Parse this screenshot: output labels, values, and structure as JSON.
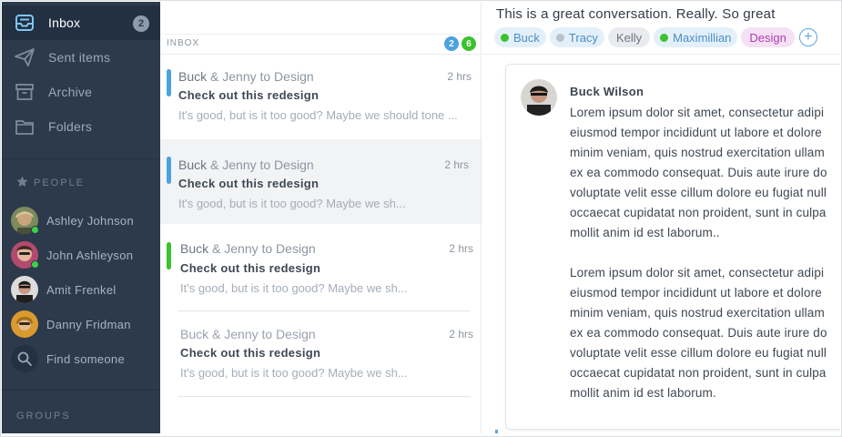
{
  "colors": {
    "sidebar_bg": "#2d3a4c",
    "sidebar_active": "#233041",
    "accent_blue": "#5aa7dd",
    "accent_green": "#3bd14a",
    "tag_design": "#c13fbf"
  },
  "sidebar": {
    "nav": [
      {
        "label": "Inbox",
        "icon": "inbox-icon",
        "badge": "2",
        "active": true
      },
      {
        "label": "Sent items",
        "icon": "paper-plane-icon"
      },
      {
        "label": "Archive",
        "icon": "archive-box-icon"
      },
      {
        "label": "Folders",
        "icon": "folder-icon"
      }
    ],
    "people_heading": "PEOPLE",
    "people": [
      {
        "name": "Ashley Johnson",
        "online": true
      },
      {
        "name": "John Ashleyson",
        "online": true
      },
      {
        "name": "Amit Frenkel",
        "online": false
      },
      {
        "name": "Danny Fridman",
        "online": false
      }
    ],
    "find_label": "Find someone",
    "groups_heading": "GROUPS"
  },
  "list": {
    "header": "INBOX",
    "counts": [
      {
        "value": "2",
        "color": "#4aa3df"
      },
      {
        "value": "6",
        "color": "#3bc22f"
      }
    ],
    "messages": [
      {
        "sender": "Buck",
        "rest": " & Jenny to Design",
        "time": "2 hrs",
        "subject": "Check out this redesign",
        "preview": "It's good, but is it too good? Maybe we should tone ...",
        "bar_color": "#4aa3df"
      },
      {
        "sender": "Buck",
        "rest": " & Jenny to Design",
        "time": "2 hrs",
        "subject": "Check out this redesign",
        "preview": "It's good, but is it too good? Maybe we sh...",
        "bar_color": "#4aa3df",
        "selected": true
      },
      {
        "sender": "Buck",
        "rest": " & Jenny to Design",
        "time": "2 hrs",
        "subject": "Check out this redesign",
        "preview": "It's good, but is it too good? Maybe we sh...",
        "bar_color": "#3bc22f"
      },
      {
        "sender": "Buck",
        "rest": " & Jenny to Design",
        "time": "2 hrs",
        "subject": "Check out this redesign",
        "preview": "It's good, but is it too good? Maybe we sh...",
        "bar_color": ""
      }
    ]
  },
  "conversation": {
    "title": "This is a great conversation. Really. So great",
    "tags": [
      {
        "label": "Buck",
        "dot": "#3bc22f",
        "bg": "#e4f0f9",
        "fg": "#4a8fc6"
      },
      {
        "label": "Tracy",
        "dot": "#b9c2cc",
        "bg": "#e4f0f9",
        "fg": "#4a8fc6"
      },
      {
        "label": "Kelly",
        "dot": "",
        "bg": "#e9ebee",
        "fg": "#6d7681"
      },
      {
        "label": "Maximillian",
        "dot": "#3bc22f",
        "bg": "#e4f0f9",
        "fg": "#4a8fc6"
      },
      {
        "label": "Design",
        "dot": "",
        "bg": "#f4e1f4",
        "fg": "#b03cb0"
      }
    ],
    "add_symbol": "+",
    "message": {
      "author": "Buck Wilson",
      "paragraphs": [
        "Lorem ipsum dolor sit amet, consectetur adipi\neiusmod tempor incididunt ut labore et dolore\nminim veniam, quis nostrud exercitation ullam\nex ea commodo consequat. Duis aute irure do\nvoluptate velit esse cillum dolore eu fugiat null\noccaecat cupidatat non proident, sunt in culpa\nmollit anim id est laborum..",
        "Lorem ipsum dolor sit amet, consectetur adipi\neiusmod tempor incididunt ut labore et dolore\nminim veniam, quis nostrud exercitation ullam\nex ea commodo consequat. Duis aute irure do\nvoluptate velit esse cillum dolore eu fugiat null\noccaecat cupidatat non proident, sunt in culpa\nmollit anim id est laborum."
      ]
    }
  }
}
